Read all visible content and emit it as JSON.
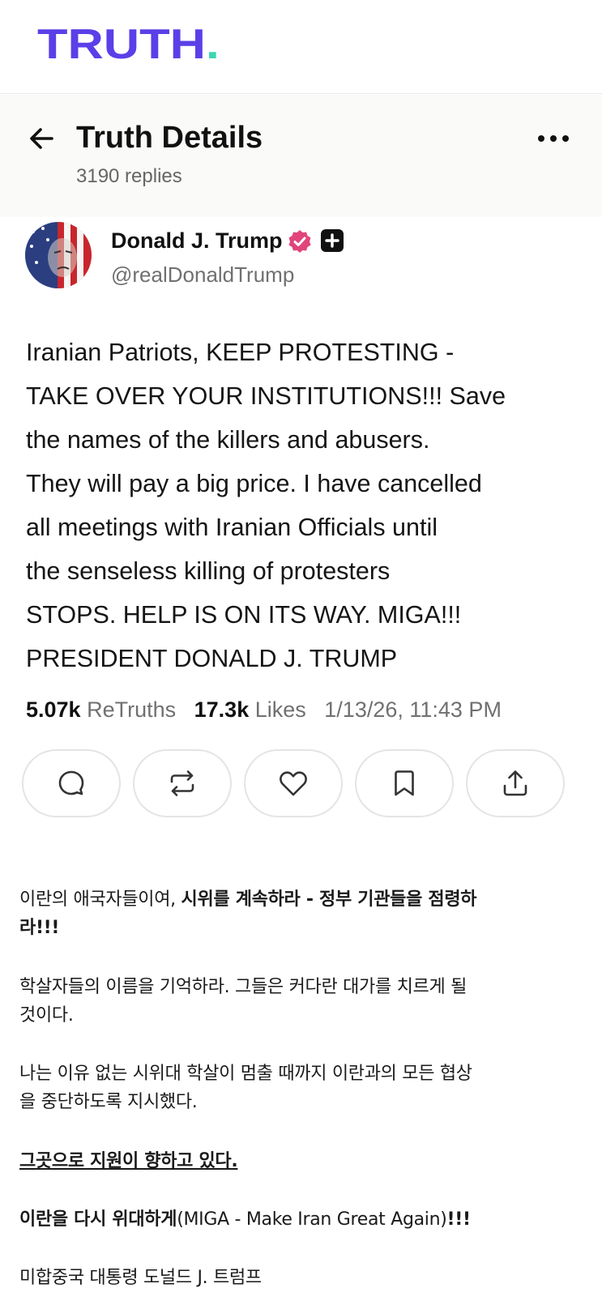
{
  "app": {
    "logo_text": "TRUTH",
    "logo_dot": ".",
    "brand_color": "#5b3fe8",
    "accent_color": "#3dd6b5"
  },
  "header": {
    "title": "Truth Details",
    "replies": "3190 replies",
    "back_icon": "arrow-left-icon",
    "more_icon": "more-horizontal-icon"
  },
  "post": {
    "author_name": "Donald J. Trump",
    "author_handle": "@realDonaldTrump",
    "verified_color": "#e0457b",
    "body_lines": [
      "Iranian Patriots, KEEP PROTESTING -",
      "TAKE OVER YOUR INSTITUTIONS!!! Save",
      "the names of the killers and abusers.",
      "They will pay a big price. I have cancelled",
      "all meetings with Iranian Officials until",
      "the senseless killing of protesters",
      "STOPS. HELP IS ON ITS WAY. MIGA!!!",
      "PRESIDENT DONALD J. TRUMP"
    ],
    "retruths_count": "5.07k",
    "retruths_label": "ReTruths",
    "likes_count": "17.3k",
    "likes_label": "Likes",
    "timestamp": "1/13/26, 11:43 PM",
    "actions": [
      "reply-icon",
      "retruth-icon",
      "like-icon",
      "bookmark-icon",
      "share-icon"
    ]
  },
  "translation": {
    "p1_plain": "이란의 애국자들이여, ",
    "p1_bold_line1": "시위를 계속하라 - 정부 기관들을 점령하",
    "p1_bold_line2": "라!!!",
    "p2_line1": "학살자들의 이름을 기억하라. 그들은 커다란 대가를 치르게 될",
    "p2_line2": "것이다.",
    "p3_line1": "나는 이유 없는 시위대 학살이 멈출 때까지 이란과의 모든 협상",
    "p3_line2": "을 중단하도록 지시했다.",
    "p4_underlined": "그곳으로 지원이 향하고 있다.",
    "p5_bold": "이란을 다시 위대하게",
    "p5_plain": "(MIGA - Make Iran Great Again)",
    "p5_bold_end": "!!!",
    "p6": "미합중국 대통령 도널드 J. 트럼프"
  }
}
